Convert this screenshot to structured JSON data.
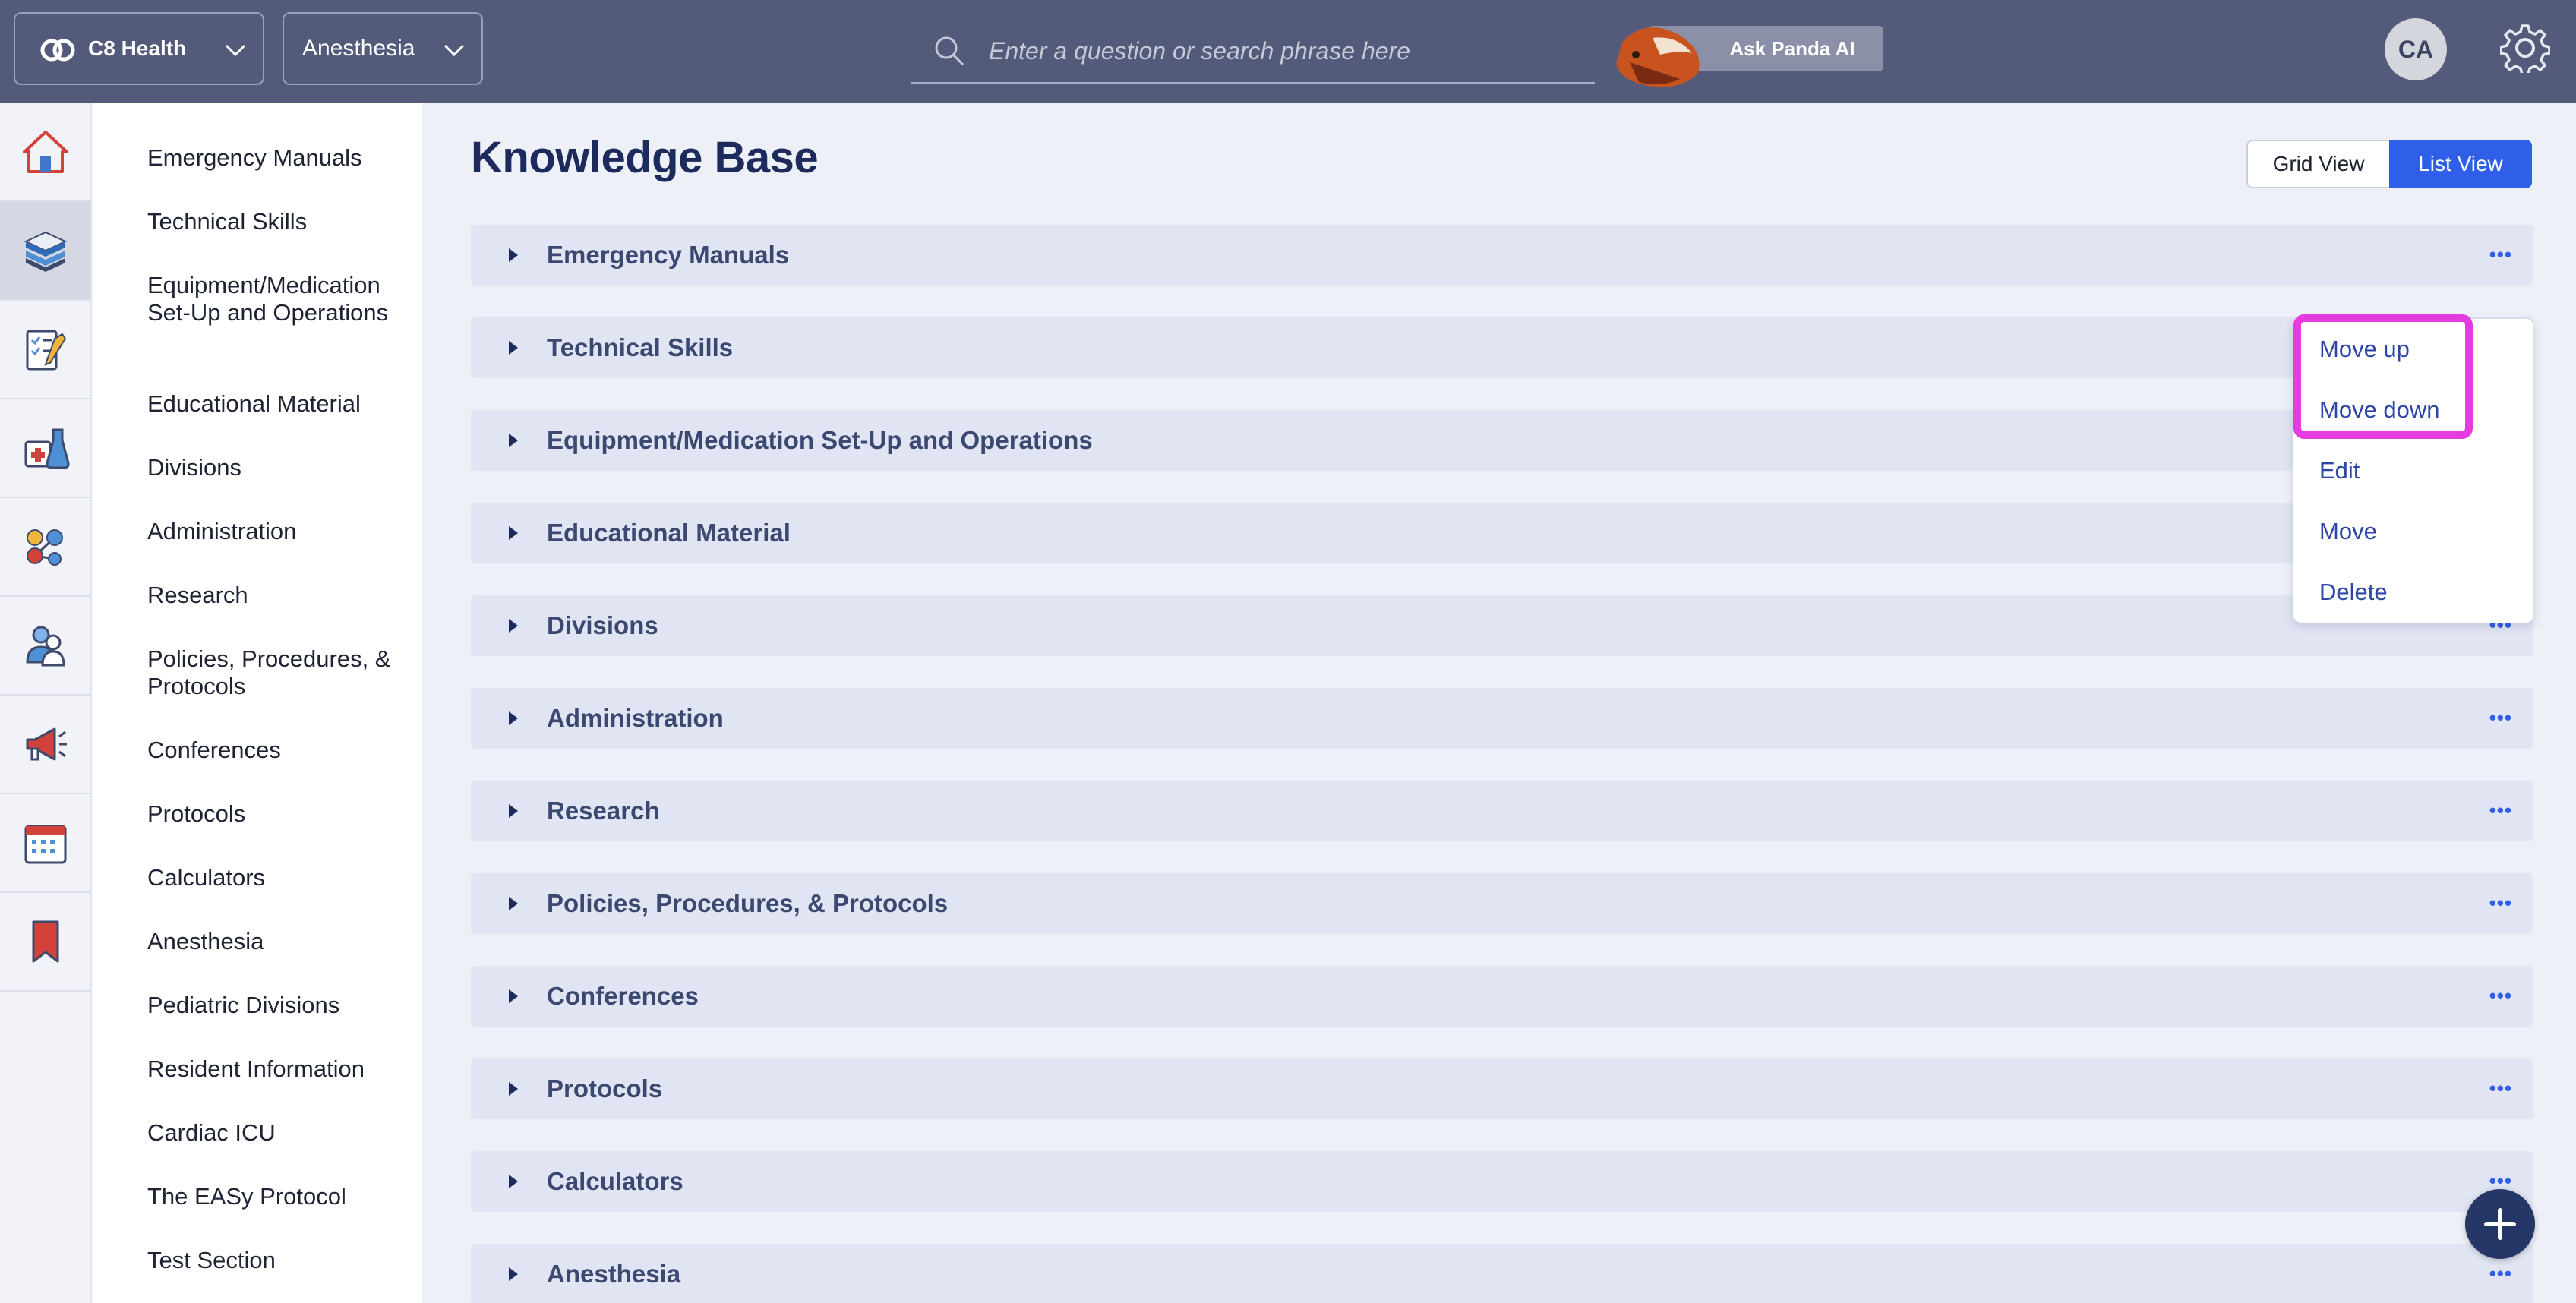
{
  "header": {
    "org_name": "C8 Health",
    "department": "Anesthesia",
    "search_placeholder": "Enter a question or search phrase here",
    "ask_ai_label": "Ask Panda AI",
    "avatar_initials": "CA"
  },
  "rail": {
    "icons": [
      "home-icon",
      "books-icon",
      "checklist-icon",
      "lab-kit-icon",
      "network-icon",
      "people-icon",
      "megaphone-icon",
      "calendar-icon",
      "bookmark-icon"
    ],
    "active": "books-icon"
  },
  "sidebar": {
    "items": [
      {
        "label": "Emergency Manuals"
      },
      {
        "label": "Technical Skills"
      },
      {
        "label": "Equipment/Medication Set-Up and Operations"
      },
      {
        "label": "Educational Material"
      },
      {
        "label": "Divisions"
      },
      {
        "label": "Administration"
      },
      {
        "label": "Research"
      },
      {
        "label": "Policies, Procedures, & Protocols"
      },
      {
        "label": "Conferences"
      },
      {
        "label": "Protocols"
      },
      {
        "label": "Calculators"
      },
      {
        "label": "Anesthesia"
      },
      {
        "label": "Pediatric Divisions"
      },
      {
        "label": "Resident Information"
      },
      {
        "label": "Cardiac ICU"
      },
      {
        "label": "The EASy Protocol"
      },
      {
        "label": "Test Section"
      }
    ]
  },
  "main": {
    "title": "Knowledge Base",
    "view_toggle": {
      "grid": "Grid View",
      "list": "List View",
      "active": "list"
    },
    "sections": [
      {
        "label": "Emergency Manuals"
      },
      {
        "label": "Technical Skills"
      },
      {
        "label": "Equipment/Medication Set-Up and Operations"
      },
      {
        "label": "Educational Material"
      },
      {
        "label": "Divisions"
      },
      {
        "label": "Administration"
      },
      {
        "label": "Research"
      },
      {
        "label": "Policies, Procedures, & Protocols"
      },
      {
        "label": "Conferences"
      },
      {
        "label": "Protocols"
      },
      {
        "label": "Calculators"
      },
      {
        "label": "Anesthesia"
      }
    ],
    "more_glyph": "•••"
  },
  "context_menu": {
    "items": [
      {
        "label": "Move up"
      },
      {
        "label": "Move down"
      },
      {
        "label": "Edit"
      },
      {
        "label": "Move"
      },
      {
        "label": "Delete"
      }
    ],
    "highlight_color": "#e43ddf"
  },
  "colors": {
    "topbar": "#535a7a",
    "accent": "#2f5fe8",
    "row_bg": "#e1e4f3",
    "fab": "#243766"
  }
}
